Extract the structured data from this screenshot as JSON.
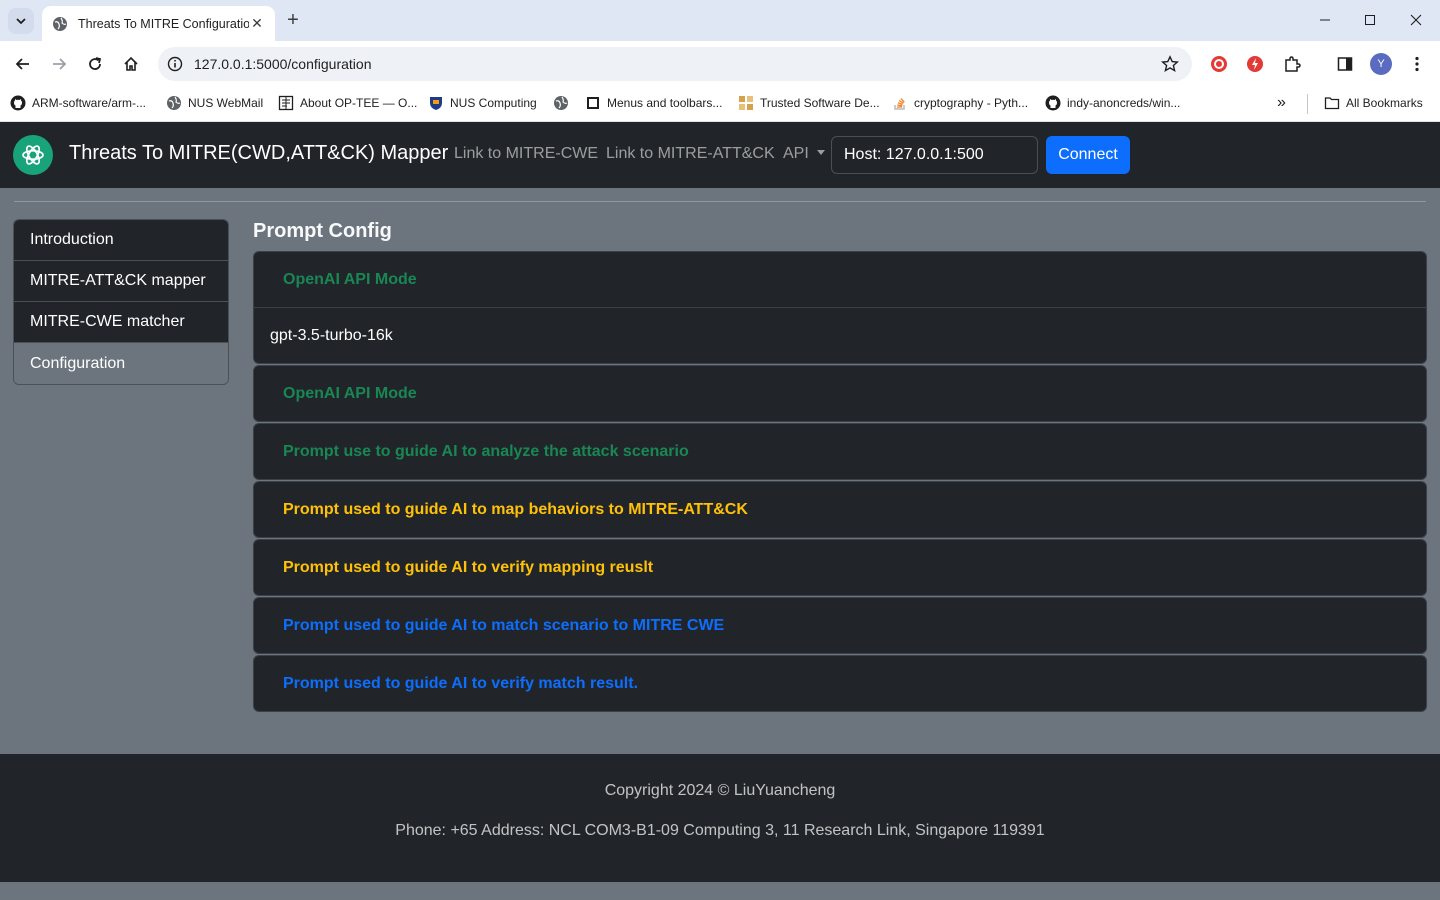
{
  "browser": {
    "tab_title": "Threats To MITRE Configuration",
    "url": "127.0.0.1:5000/configuration",
    "profile_initial": "Y",
    "bookmarks": [
      {
        "label": "ARM-software/arm-...",
        "icon": "github-icon"
      },
      {
        "label": "NUS WebMail",
        "icon": "globe-icon"
      },
      {
        "label": "About OP-TEE — O...",
        "icon": "document-icon"
      },
      {
        "label": "NUS Computing",
        "icon": "crest-icon"
      },
      {
        "label": "",
        "icon": "globe-icon"
      },
      {
        "label": "Menus and toolbars...",
        "icon": "square-icon"
      },
      {
        "label": "Trusted Software De...",
        "icon": "grid-icon"
      },
      {
        "label": "cryptography - Pyth...",
        "icon": "stackoverflow-icon"
      },
      {
        "label": "indy-anoncreds/win...",
        "icon": "github-icon"
      }
    ],
    "all_bookmarks": "All Bookmarks",
    "overflow": "»"
  },
  "navbar": {
    "brand": "Threats To MITRE(CWD,ATT&CK) Mapper",
    "links": [
      "Link to MITRE-CWE",
      "Link to MITRE-ATT&CK",
      "API"
    ],
    "host_value": "Host: 127.0.0.1:500",
    "connect_label": "Connect"
  },
  "sidebar": {
    "items": [
      {
        "label": "Introduction",
        "active": false
      },
      {
        "label": "MITRE-ATT&CK mapper",
        "active": false
      },
      {
        "label": "MITRE-CWE matcher",
        "active": false
      },
      {
        "label": "Configuration",
        "active": true
      }
    ]
  },
  "main": {
    "title": "Prompt Config",
    "accordion": [
      {
        "header": "OpenAI API Mode",
        "color": "#198754",
        "body": "gpt-3.5-turbo-16k",
        "expanded": true
      },
      {
        "header": "OpenAI API Mode",
        "color": "#198754",
        "expanded": false
      },
      {
        "header": "Prompt use to guide AI to analyze the attack scenario",
        "color": "#198754",
        "expanded": false
      },
      {
        "header": "Prompt used to guide AI to map behaviors to MITRE-ATT&CK",
        "color": "#ffc107",
        "expanded": false
      },
      {
        "header": "Prompt used to guide AI to verify mapping reuslt",
        "color": "#ffc107",
        "expanded": false
      },
      {
        "header": "Prompt used to guide AI to match scenario to MITRE CWE",
        "color": "#0d6efd",
        "expanded": false
      },
      {
        "header": "Prompt used to guide AI to verify match result.",
        "color": "#0d6efd",
        "expanded": false
      }
    ]
  },
  "footer": {
    "copyright": "Copyright 2024 © LiuYuancheng",
    "contact": "Phone: +65 Address: NCL COM3-B1-09 Computing 3, 11 Research Link, Singapore 119391"
  }
}
